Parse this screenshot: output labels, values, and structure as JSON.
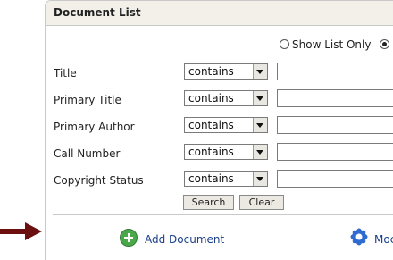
{
  "panel": {
    "title": "Document List"
  },
  "view_options": [
    {
      "label": "Show List Only",
      "checked": false
    },
    {
      "label": "",
      "checked": true
    }
  ],
  "fields": [
    {
      "label": "Title",
      "operator": "contains",
      "value": ""
    },
    {
      "label": "Primary Title",
      "operator": "contains",
      "value": ""
    },
    {
      "label": "Primary Author",
      "operator": "contains",
      "value": ""
    },
    {
      "label": "Call Number",
      "operator": "contains",
      "value": ""
    },
    {
      "label": "Copyright Status",
      "operator": "contains",
      "value": ""
    }
  ],
  "buttons": {
    "search": "Search",
    "clear": "Clear"
  },
  "actions": {
    "add_document": "Add Document",
    "second_action": "Moc"
  },
  "colors": {
    "header_bg": "#f2f0e8",
    "link": "#1b3f8b",
    "arrow": "#6b0f0f",
    "add_icon": "#4aa84a"
  },
  "icons": {
    "add": "plus-circle-icon",
    "second": "gear-icon",
    "pointer": "arrow-right-icon"
  }
}
